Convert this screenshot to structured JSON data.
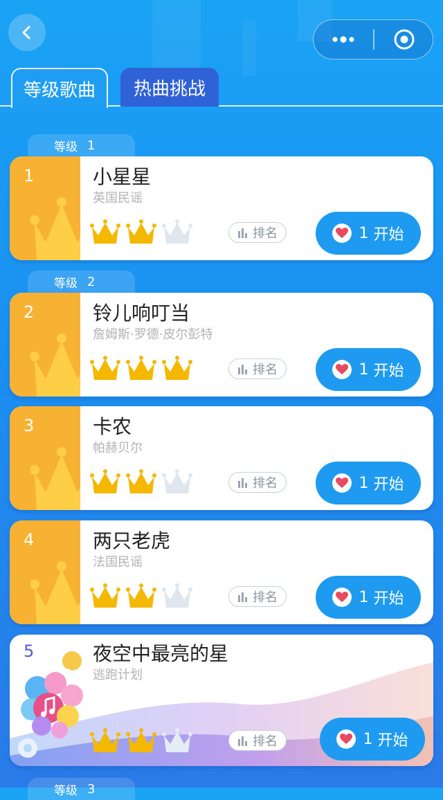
{
  "tabs": [
    {
      "label": "等级歌曲",
      "active": true
    },
    {
      "label": "热曲挑战",
      "active": false
    }
  ],
  "levels": [
    {
      "word": "等级",
      "num": "1"
    },
    {
      "word": "等级",
      "num": "2"
    },
    {
      "word": "等级",
      "num": "3"
    }
  ],
  "songs": [
    {
      "num": "1",
      "title": "小星星",
      "artist": "英国民谣",
      "crowns_earned": 2,
      "crowns_total": 3,
      "rank_label": "排名",
      "start_count": "1",
      "start_label": "开始"
    },
    {
      "num": "2",
      "title": "铃儿响叮当",
      "artist": "詹姆斯·罗德·皮尔彭特",
      "crowns_earned": 3,
      "crowns_total": 3,
      "rank_label": "排名",
      "start_count": "1",
      "start_label": "开始"
    },
    {
      "num": "3",
      "title": "卡农",
      "artist": "帕赫贝尔",
      "crowns_earned": 2,
      "crowns_total": 3,
      "rank_label": "排名",
      "start_count": "1",
      "start_label": "开始"
    },
    {
      "num": "4",
      "title": "两只老虎",
      "artist": "法国民谣",
      "crowns_earned": 2,
      "crowns_total": 3,
      "rank_label": "排名",
      "start_count": "1",
      "start_label": "开始"
    },
    {
      "num": "5",
      "title": "夜空中最亮的星",
      "artist": "逃跑计划",
      "crowns_earned": 2,
      "crowns_total": 3,
      "rank_label": "排名",
      "start_count": "1",
      "start_label": "开始"
    }
  ],
  "colors": {
    "accent_blue": "#1e9bf0",
    "card_side_orange": "#f7b233",
    "crown_gold": "#f5b800",
    "crown_empty": "#dfe6ee",
    "heart_red": "#e84a5f"
  },
  "icons": {
    "back": "back-arrow-icon",
    "more": "more-dots-icon",
    "target": "target-icon",
    "rank": "bar-chart-icon",
    "heart": "heart-icon",
    "crown": "crown-icon",
    "music": "music-note-icon"
  }
}
